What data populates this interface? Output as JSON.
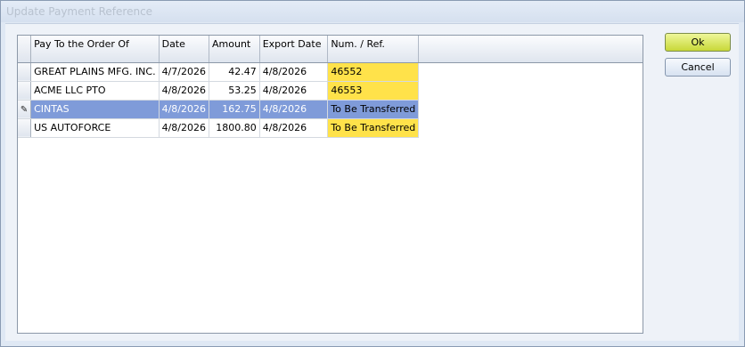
{
  "window": {
    "title": "Update Payment Reference"
  },
  "grid": {
    "columns": [
      "Pay To the Order Of",
      "Date",
      "Amount",
      "Export Date",
      "Num. / Ref."
    ],
    "rows": [
      {
        "payee": "GREAT PLAINS MFG. INC.",
        "date": "4/7/2026",
        "amount": "42.47",
        "export_date": "4/8/2026",
        "ref": "46552"
      },
      {
        "payee": "ACME LLC PTO",
        "date": "4/8/2026",
        "amount": "53.25",
        "export_date": "4/8/2026",
        "ref": "46553"
      },
      {
        "payee": "CINTAS",
        "date": "4/8/2026",
        "amount": "162.75",
        "export_date": "4/8/2026",
        "ref": "To Be Transferred"
      },
      {
        "payee": "US AUTOFORCE",
        "date": "4/8/2026",
        "amount": "1800.80",
        "export_date": "4/8/2026",
        "ref": "To Be Transferred"
      }
    ],
    "selected_row": 2,
    "editing_indicator_icon": "pencil-icon"
  },
  "buttons": {
    "ok": "Ok",
    "cancel": "Cancel"
  },
  "colors": {
    "ref_highlight": "#ffe24a",
    "selection": "#7f9bd9",
    "ok_button": "#d7e45a"
  }
}
